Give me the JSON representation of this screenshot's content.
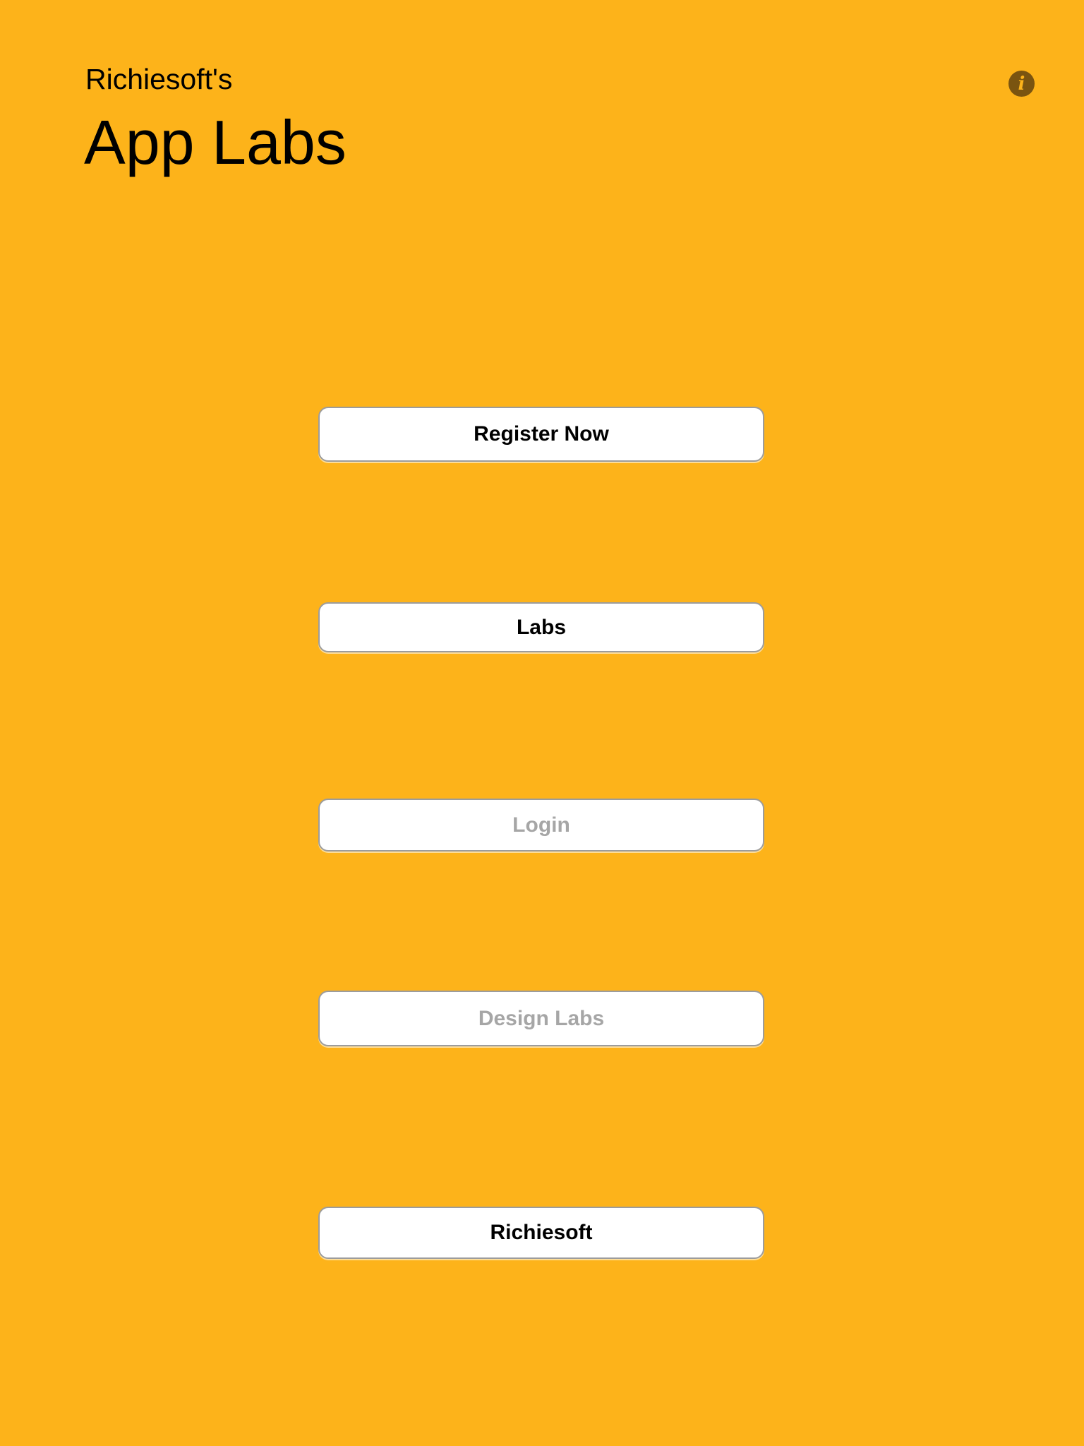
{
  "header": {
    "subtitle": "Richiesoft's",
    "title": "App Labs",
    "info_icon": "info-icon",
    "info_glyph": "i"
  },
  "colors": {
    "background": "#FDB31A",
    "button_background": "#FFFFFF",
    "button_border": "#9C9C9C",
    "enabled_text": "#000000",
    "disabled_text": "#A6A6A6",
    "info_icon_fill": "#7A5410"
  },
  "menu": {
    "register_label": "Register Now",
    "labs_label": "Labs",
    "login_label": "Login",
    "design_labs_label": "Design Labs",
    "richiesoft_label": "Richiesoft"
  }
}
